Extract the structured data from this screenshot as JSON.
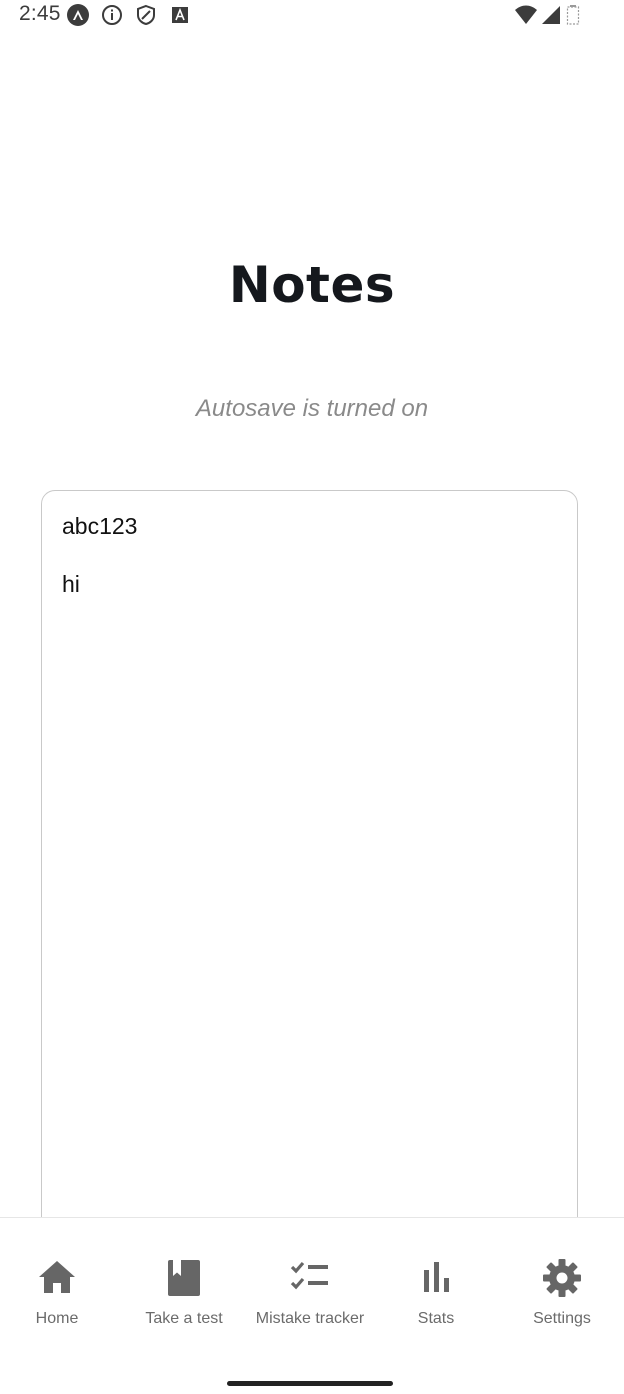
{
  "status_bar": {
    "time": "2:45",
    "left_icons": [
      "app-icon",
      "info-icon",
      "shield-icon",
      "font-icon"
    ],
    "right_icons": [
      "wifi-icon",
      "signal-icon",
      "battery-icon"
    ]
  },
  "page": {
    "title": "Notes",
    "autosave_text": "Autosave is turned on"
  },
  "notes": {
    "lines": [
      "abc123",
      "hi"
    ]
  },
  "bottom_nav": {
    "items": [
      {
        "label": "Home",
        "icon": "home-icon"
      },
      {
        "label": "Take a test",
        "icon": "book-icon"
      },
      {
        "label": "Mistake tracker",
        "icon": "checklist-icon"
      },
      {
        "label": "Stats",
        "icon": "bar-chart-icon"
      },
      {
        "label": "Settings",
        "icon": "gear-icon"
      }
    ]
  },
  "colors": {
    "icon": "#666666",
    "label": "#6b6b6b",
    "title": "#15181d",
    "subtitle": "#8a8a8a"
  }
}
